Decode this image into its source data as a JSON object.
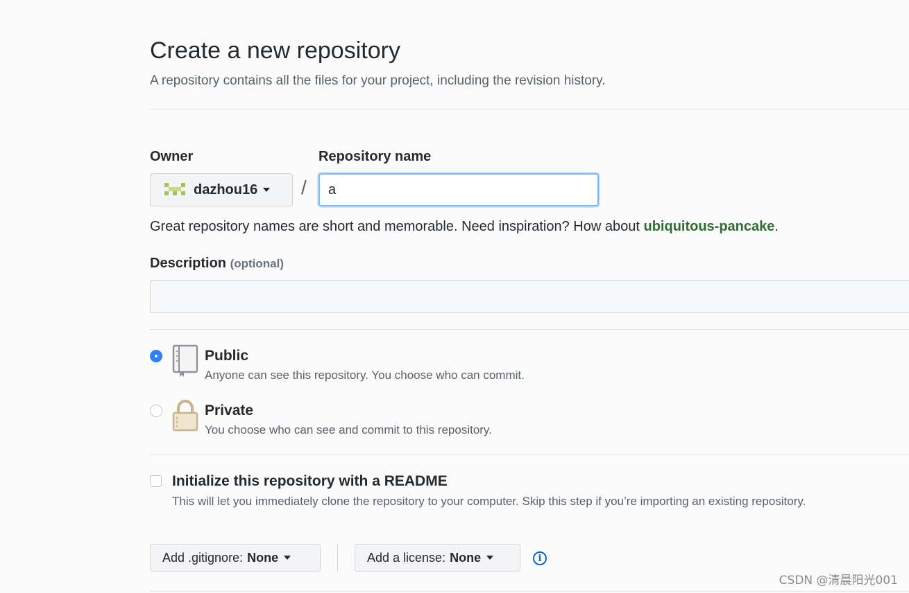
{
  "header": {
    "title": "Create a new repository",
    "subtitle": "A repository contains all the files for your project, including the revision history."
  },
  "owner": {
    "label": "Owner",
    "value": "dazhou16"
  },
  "repo_name": {
    "label": "Repository name",
    "value": "a",
    "separator": "/"
  },
  "name_hint": {
    "text": "Great repository names are short and memorable. Need inspiration? How about ",
    "suggestion": "ubiquitous-pancake",
    "suffix": "."
  },
  "description": {
    "label": "Description",
    "optional": "(optional)",
    "value": ""
  },
  "visibility": {
    "public": {
      "title": "Public",
      "desc": "Anyone can see this repository. You choose who can commit.",
      "selected": true
    },
    "private": {
      "title": "Private",
      "desc": "You choose who can see and commit to this repository.",
      "selected": false
    }
  },
  "readme": {
    "title": "Initialize this repository with a README",
    "desc": "This will let you immediately clone the repository to your computer. Skip this step if you’re importing an existing repository.",
    "checked": false
  },
  "gitignore": {
    "label": "Add .gitignore:",
    "value": "None"
  },
  "license": {
    "label": "Add a license:",
    "value": "None"
  },
  "watermark": "CSDN @清晨阳光001",
  "colors": {
    "accent": "#2f81f7",
    "suggestion": "#2c6e2c",
    "focus_border": "#79b8ff"
  },
  "icons": [
    "avatar-icon",
    "book-icon",
    "lock-icon",
    "info-icon",
    "caret-down-icon"
  ]
}
